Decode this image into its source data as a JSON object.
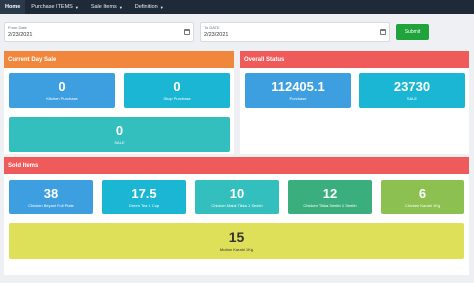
{
  "nav": {
    "home": "Home",
    "purchase": "Purchase ITEMS",
    "sale": "Sale Items",
    "definition": "Definition"
  },
  "filters": {
    "from_label": "From Date",
    "from_value": "2/23/2021",
    "to_label": "To DATE",
    "to_value": "2/23/2021",
    "submit": "Submit"
  },
  "current_day": {
    "title": "Current Day Sale",
    "color": "#f0873c",
    "tiles": [
      {
        "value": "0",
        "label": "Kitchen Purchase",
        "color": "#3d9fe0"
      },
      {
        "value": "0",
        "label": "Shop Purchase",
        "color": "#1ab6d4"
      },
      {
        "value": "0",
        "label": "SALE",
        "color": "#33bfbd"
      }
    ]
  },
  "overall": {
    "title": "Overall Status",
    "color": "#ef5b5b",
    "tiles": [
      {
        "value": "112405.1",
        "label": "Purchase",
        "color": "#3d9fe0"
      },
      {
        "value": "23730",
        "label": "SALE",
        "color": "#1ab6d4"
      }
    ]
  },
  "sold": {
    "title": "Sold Items",
    "color": "#ef5b5b",
    "tiles": [
      {
        "value": "38",
        "label": "Chicken Beyani Full Plate",
        "color": "#3d9fe0"
      },
      {
        "value": "17.5",
        "label": "Green Tea 1 Cup",
        "color": "#1ab6d4"
      },
      {
        "value": "10",
        "label": "Chicken Malai Tikka 1 Seekh",
        "color": "#33bfbd"
      },
      {
        "value": "12",
        "label": "Chicken Tikka Seekh 1 Seekh",
        "color": "#3aaf7d"
      },
      {
        "value": "6",
        "label": "Chicken Karahi 1Kg",
        "color": "#8cc152"
      },
      {
        "value": "15",
        "label": "Mutton Karahi 1Kg",
        "color": "#dfe05a"
      }
    ]
  }
}
